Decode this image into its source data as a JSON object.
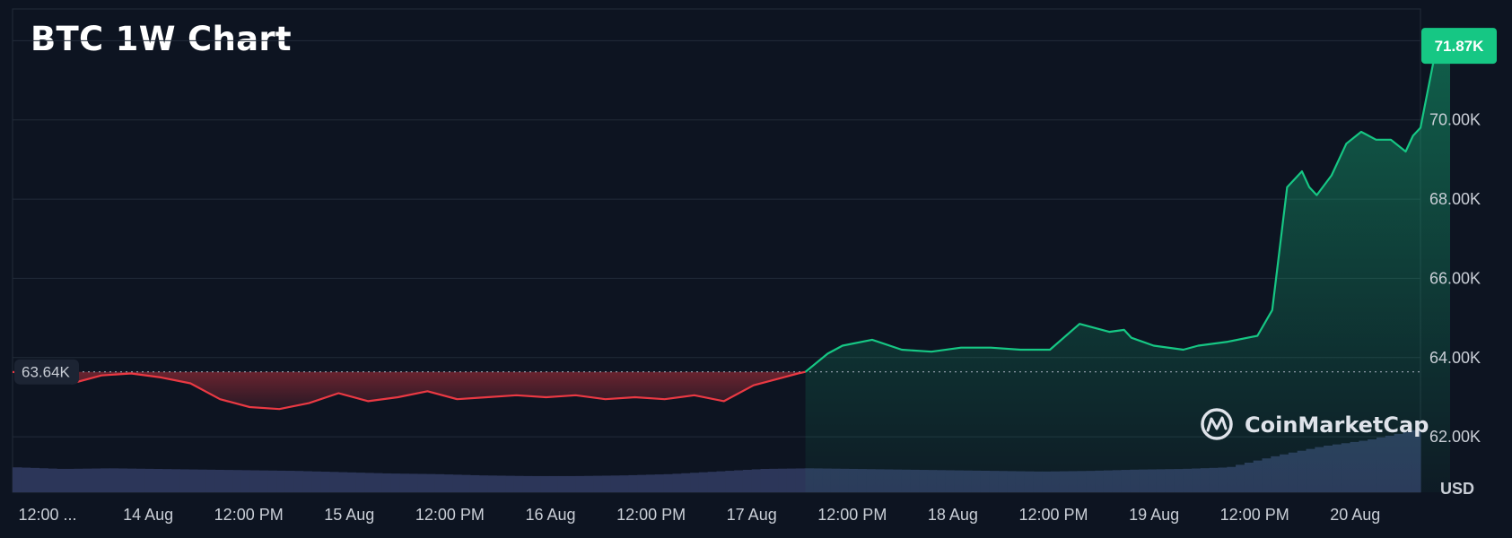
{
  "chart_data": {
    "type": "area",
    "title": "BTC 1W Chart",
    "currency_label": "USD",
    "watermark": "CoinMarketCap",
    "baseline": {
      "value": 63.64,
      "label": "63.64K"
    },
    "last_price": {
      "value": 71.87,
      "label": "71.87K"
    },
    "y_unit": "K USD",
    "ylim": [
      60.6,
      72.8
    ],
    "y_ticks": [
      {
        "value": 62,
        "label": "62.00K"
      },
      {
        "value": 64,
        "label": "64.00K"
      },
      {
        "value": 66,
        "label": "66.00K"
      },
      {
        "value": 68,
        "label": "68.00K"
      },
      {
        "value": 70,
        "label": "70.00K"
      }
    ],
    "x_ticks": [
      "12:00 ...",
      "14 Aug",
      "12:00 PM",
      "15 Aug",
      "12:00 PM",
      "16 Aug",
      "12:00 PM",
      "17 Aug",
      "12:00 PM",
      "18 Aug",
      "12:00 PM",
      "19 Aug",
      "12:00 PM",
      "20 Aug"
    ],
    "xlim": [
      "13 Aug 00:00",
      "20 Aug 22:00"
    ],
    "x_hours": [
      0,
      8,
      12,
      16,
      20,
      24,
      28,
      32,
      36,
      40,
      44,
      48,
      52,
      56,
      60,
      64,
      68,
      72,
      76,
      80,
      84,
      88,
      92,
      96,
      100,
      104,
      106,
      107,
      110,
      112,
      116,
      120,
      124,
      128,
      132,
      136,
      140,
      144,
      148,
      150,
      151,
      154,
      158,
      160,
      164,
      168,
      170,
      172,
      174,
      175,
      176,
      178,
      180,
      182,
      184,
      186,
      188,
      189,
      190,
      192,
      194
    ],
    "series": [
      {
        "values": [
          63.64,
          63.35,
          63.55,
          63.6,
          63.5,
          63.35,
          62.95,
          62.75,
          62.7,
          62.85,
          63.1,
          62.9,
          63.0,
          63.15,
          62.95,
          63.0,
          63.05,
          63.0,
          63.05,
          62.95,
          63.0,
          62.95,
          63.05,
          62.9,
          63.3,
          63.5,
          63.6,
          63.64,
          64.1,
          64.3,
          64.45,
          64.2,
          64.15,
          64.25,
          64.25,
          64.2,
          64.2,
          64.85,
          64.65,
          64.7,
          64.5,
          64.3,
          64.2,
          64.3,
          64.4,
          64.55,
          65.2,
          68.3,
          68.7,
          68.3,
          68.1,
          68.6,
          69.4,
          69.7,
          69.5,
          69.5,
          69.2,
          69.6,
          69.8,
          71.7,
          71.87
        ],
        "color_down": "#ea3943",
        "color_up": "#16c784"
      }
    ],
    "volume": [
      0.55,
      0.5,
      0.52,
      0.5,
      0.48,
      0.46,
      0.44,
      0.4,
      0.36,
      0.34,
      0.3,
      0.28,
      0.28,
      0.3,
      0.34,
      0.42,
      0.5,
      0.52,
      0.5,
      0.48,
      0.46,
      0.44,
      0.42,
      0.44,
      0.48,
      0.5,
      0.55,
      0.9,
      1.2,
      1.4,
      1.7
    ],
    "legend": "none",
    "grid": "horizontal",
    "colors": {
      "background": "#0d1421",
      "grid": "#222b39",
      "volume": "#2c3659",
      "badge": "#16c784"
    }
  }
}
